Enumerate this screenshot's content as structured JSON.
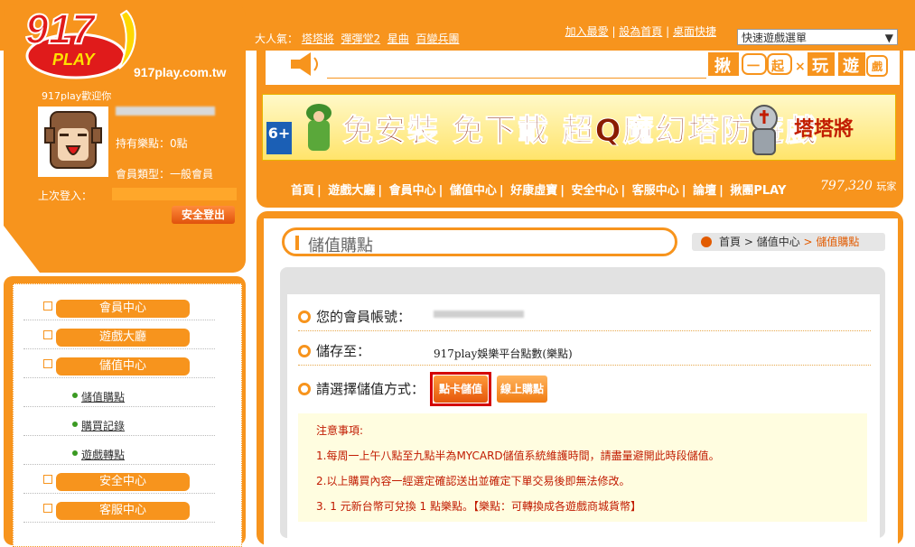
{
  "site": {
    "logo_text": "917 PLAY",
    "logo_tagline": "揪一起",
    "url": "917play.com.tw"
  },
  "topbar": {
    "hot_label": "大人氣：",
    "hot_games": [
      "塔塔將",
      "彈彈堂2",
      "星曲",
      "百變兵團"
    ],
    "links": [
      "加入最愛",
      "設為首頁",
      "桌面快捷"
    ],
    "quick_select": "快速遊戲選單"
  },
  "slogan": {
    "text": "揪一起×玩遊戲"
  },
  "banner": {
    "age": "6+",
    "headline": "免安裝 免下載 超Q魔幻塔防遊戲",
    "game_name": "塔塔將"
  },
  "nav": {
    "items": [
      "首頁",
      "遊戲大廳",
      "會員中心",
      "儲值中心",
      "好康虛寶",
      "安全中心",
      "客服中心",
      "論壇",
      "揪團PLAY"
    ],
    "online_count": "797,320",
    "online_unit": "玩家"
  },
  "profile": {
    "welcome": "917play歡迎你",
    "points_label": "持有樂點：0點",
    "member_type_label": "會員類型：一般會員",
    "last_login_label": "上次登入：",
    "logout_label": "安全登出"
  },
  "sidebar": {
    "sections": [
      {
        "label": "會員中心"
      },
      {
        "label": "遊戲大廳"
      },
      {
        "label": "儲值中心"
      },
      {
        "label": "安全中心"
      },
      {
        "label": "客服中心"
      }
    ],
    "sub_items": [
      "儲值購點",
      "購買記錄",
      "遊戲轉點"
    ]
  },
  "main": {
    "title": "儲值購點",
    "breadcrumb": {
      "home": "首頁",
      "sep": " > ",
      "parent": "儲值中心",
      "current": "儲值購點"
    },
    "account_label": "您的會員帳號：",
    "store_label": "儲存至：",
    "store_value": "917play娛樂平台點數(樂點)",
    "method_label": "請選擇儲值方式：",
    "card_button": "點卡儲值",
    "online_button": "線上購點",
    "notice_title": "注意事項:",
    "notices": [
      "1.每周一上午八點至九點半為MYCARD儲值系統維護時間，請盡量避開此時段儲值。",
      "2.以上購買內容一經選定確認送出並確定下單交易後即無法修改。",
      "3. 1 元新台幣可兌換 1 點樂點。【樂點：可轉換成各遊戲商城貨幣】"
    ]
  },
  "colors": {
    "brand": "#f7941d",
    "alert": "#c11a00",
    "highlight_border": "#d40000"
  }
}
